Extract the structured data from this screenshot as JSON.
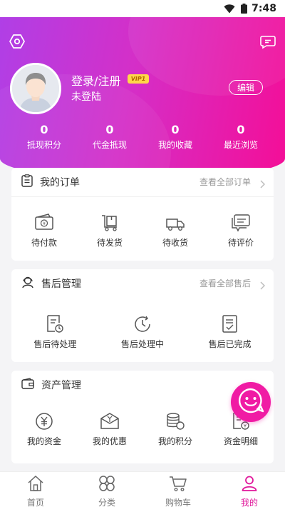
{
  "status_bar": {
    "time": "7:48",
    "icons": [
      "wifi-icon",
      "battery-icon"
    ]
  },
  "header": {
    "settings_icon": "settings-hexagon-icon",
    "message_icon": "message-icon",
    "user_name": "登录/注册",
    "vip_label": "VIP1",
    "user_status": "未登陆",
    "edit_label": "编辑",
    "stats": [
      {
        "value": "0",
        "label": "抵现积分"
      },
      {
        "value": "0",
        "label": "代金抵现"
      },
      {
        "value": "0",
        "label": "我的收藏"
      },
      {
        "value": "0",
        "label": "最近浏览"
      }
    ]
  },
  "orders": {
    "title": "我的订单",
    "more": "查看全部订单",
    "items": [
      {
        "label": "待付款",
        "icon": "wallet-icon"
      },
      {
        "label": "待发货",
        "icon": "package-icon"
      },
      {
        "label": "待收货",
        "icon": "truck-icon"
      },
      {
        "label": "待评价",
        "icon": "comment-icon"
      }
    ]
  },
  "after_sales": {
    "title": "售后管理",
    "more": "查看全部售后",
    "items": [
      {
        "label": "售后待处理",
        "icon": "pending-doc-icon"
      },
      {
        "label": "售后处理中",
        "icon": "clock-icon"
      },
      {
        "label": "售后已完成",
        "icon": "done-doc-icon"
      }
    ]
  },
  "assets": {
    "title": "资产管理",
    "items": [
      {
        "label": "我的资金",
        "icon": "yuan-coin-icon"
      },
      {
        "label": "我的优惠",
        "icon": "coupon-icon"
      },
      {
        "label": "我的积分",
        "icon": "points-icon"
      },
      {
        "label": "资金明细",
        "icon": "fund-detail-icon"
      }
    ]
  },
  "tabbar": {
    "active": "我的",
    "items": [
      {
        "label": "首页",
        "icon": "home-icon"
      },
      {
        "label": "分类",
        "icon": "category-icon"
      },
      {
        "label": "购物车",
        "icon": "cart-icon"
      },
      {
        "label": "我的",
        "icon": "user-icon"
      }
    ]
  },
  "colors": {
    "accent": "#e0189b",
    "gradient_start": "#b03fe6",
    "gradient_end": "#f40e97",
    "vip": "#ffd74a"
  }
}
